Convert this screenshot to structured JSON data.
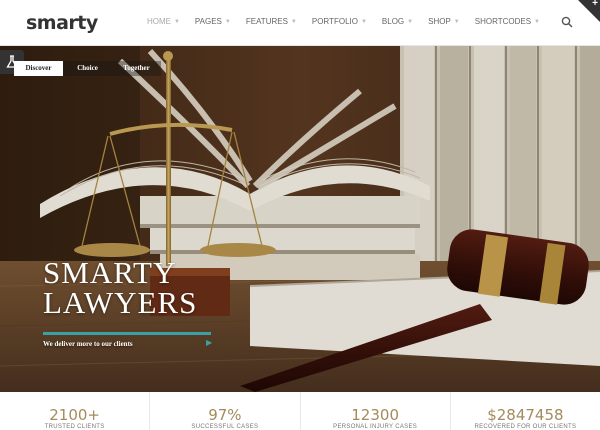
{
  "header": {
    "logo": "smarty",
    "nav": [
      {
        "label": "HOME",
        "active": true
      },
      {
        "label": "PAGES"
      },
      {
        "label": "FEATURES"
      },
      {
        "label": "PORTFOLIO"
      },
      {
        "label": "BLOG"
      },
      {
        "label": "SHOP"
      },
      {
        "label": "SHORTCODES"
      }
    ],
    "search_icon": "search-icon",
    "corner_icon": "plus-icon"
  },
  "hero": {
    "tabs": [
      "Discover",
      "Choice",
      "Together"
    ],
    "active_tab": "Discover",
    "headline_line1": "SMARTY",
    "headline_line2": "LAWYERS",
    "tagline": "We deliver more to our clients",
    "accent_color": "#3aa2a5",
    "side_tool_icon": "flask-icon"
  },
  "stats": [
    {
      "value": "2100+",
      "label": "TRUSTED CLIENTS"
    },
    {
      "value": "97%",
      "label": "SUCCESSFUL CASES"
    },
    {
      "value": "12300",
      "label": "PERSONAL INJURY CASES"
    },
    {
      "value": "$2847458",
      "label": "RECOVERED FOR OUR CLIENTS"
    }
  ],
  "colors": {
    "stat_value": "#a58a5c",
    "header_text": "#666666"
  }
}
